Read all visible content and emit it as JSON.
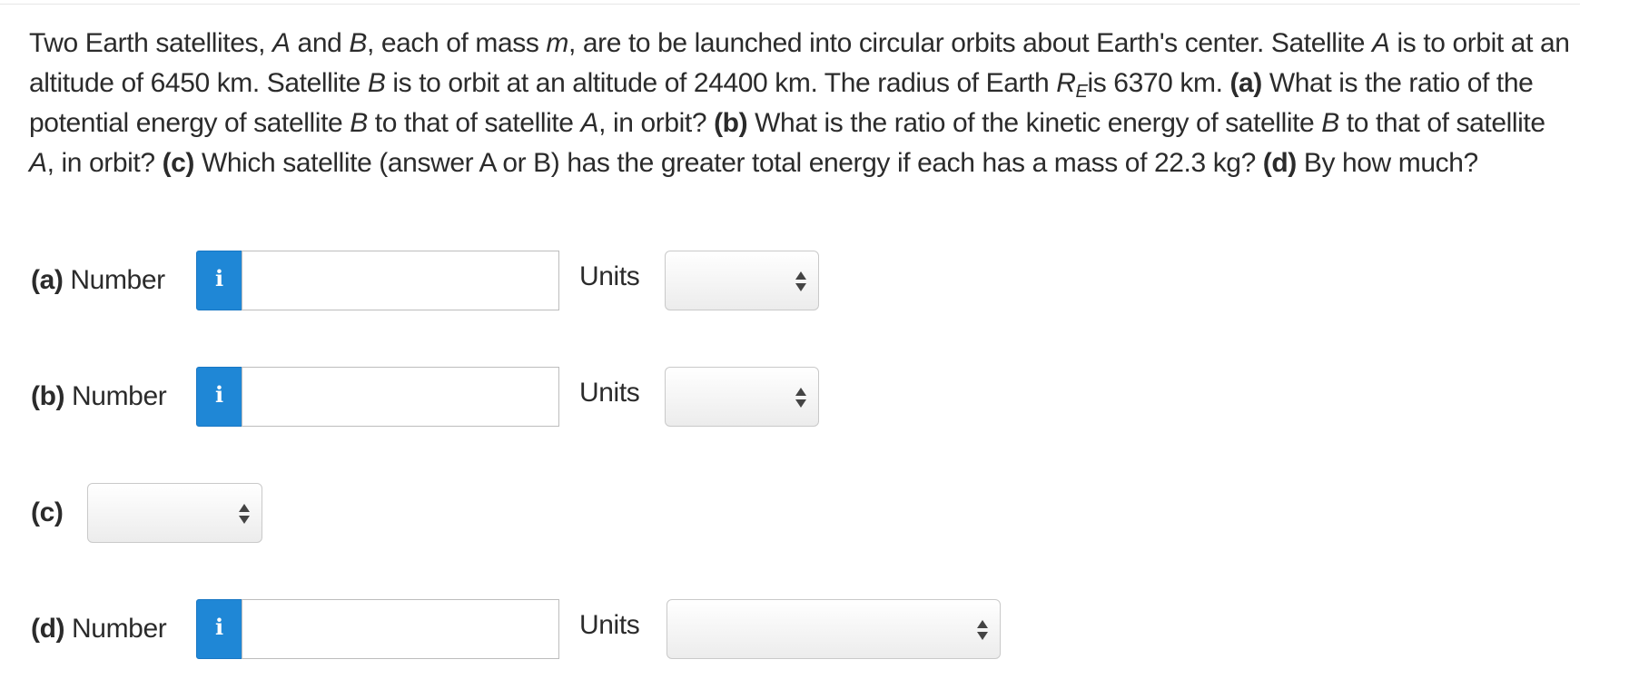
{
  "question": {
    "p1": "Two Earth satellites, ",
    "a1": "A",
    "p2": " and ",
    "b1": "B",
    "p3": ", each of mass ",
    "m": "m",
    "p4": ", are to be launched into circular orbits about Earth's center. Satellite ",
    "a2": "A",
    "p5": " is to orbit at an altitude of 6450 km. Satellite ",
    "b2": "B",
    "p6": " is to orbit at an altitude of 24400 km. The radius of Earth ",
    "r": "R",
    "e": "E",
    "p7": "is 6370 km. ",
    "qa": "(a)",
    "p8": " What is the ratio of the potential energy of satellite ",
    "b3": "B",
    "p9": " to that of satellite ",
    "a3": "A",
    "p10": ", in orbit? ",
    "qb": "(b)",
    "p11": " What is the ratio of the kinetic energy of satellite ",
    "b4": "B",
    "p12": " to that of satellite ",
    "a4": "A",
    "p13": ", in orbit? ",
    "qc": "(c)",
    "p14": " Which satellite (answer A or B) has the greater total energy if each has a mass of 22.3 kg? ",
    "qd": "(d)",
    "p15": " By how much?"
  },
  "parts": {
    "a": {
      "tag": "(a)",
      "label": " Number",
      "info": "i",
      "value": "",
      "units_label": "Units",
      "units_value": ""
    },
    "b": {
      "tag": "(b)",
      "label": " Number",
      "info": "i",
      "value": "",
      "units_label": "Units",
      "units_value": ""
    },
    "c": {
      "tag": "(c)",
      "select_value": ""
    },
    "d": {
      "tag": "(d)",
      "label": " Number",
      "info": "i",
      "value": "",
      "units_label": "Units",
      "units_value": ""
    }
  },
  "colors": {
    "info_button": "#1f87d6",
    "text": "#2b2b2b",
    "select_border": "#c9c9c9"
  },
  "icons": {
    "info": "info-icon",
    "select": "up-down-arrows-icon"
  }
}
